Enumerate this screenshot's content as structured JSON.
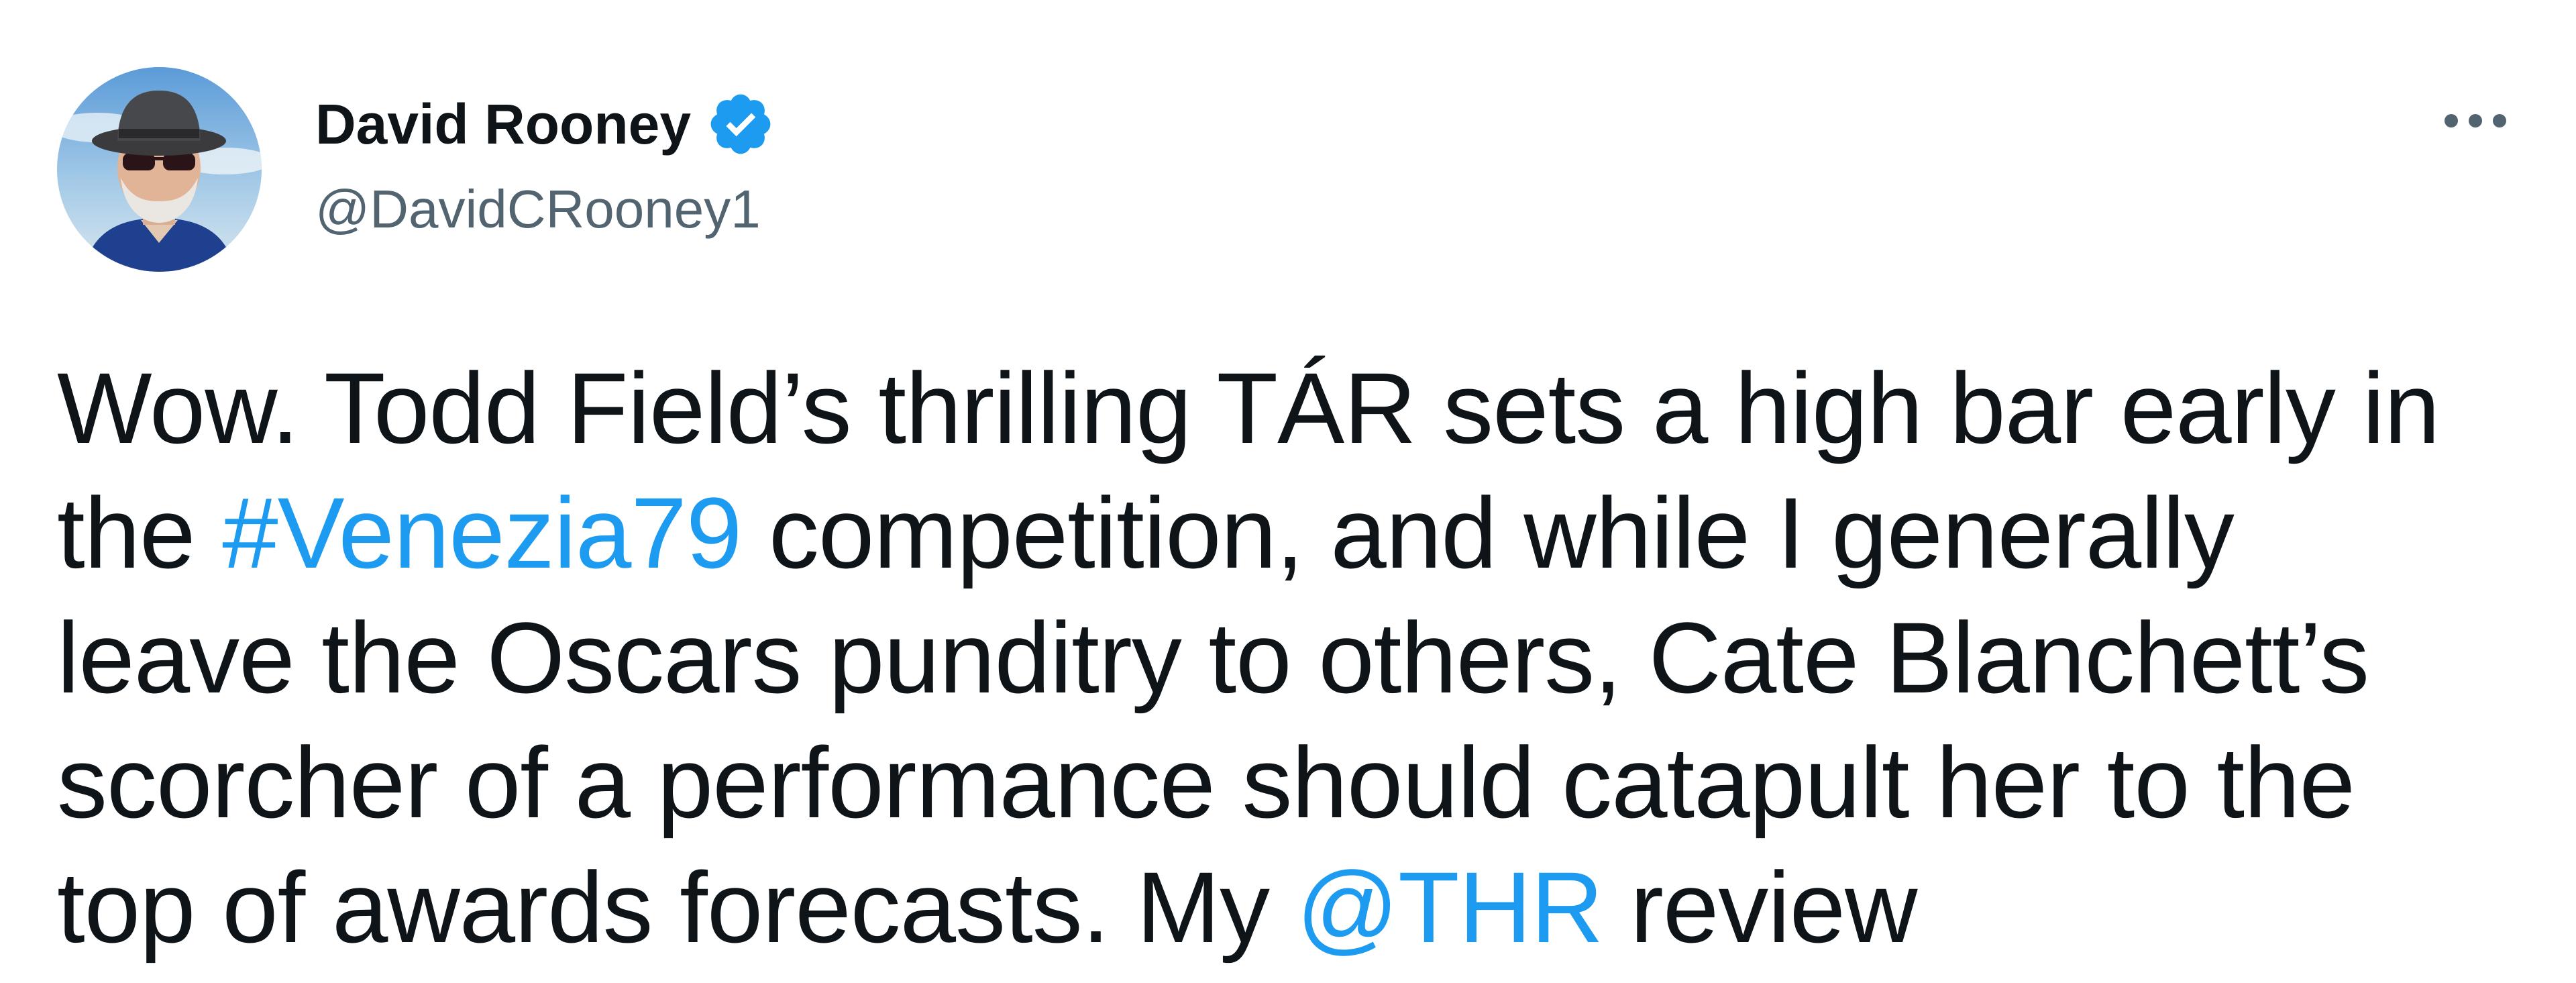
{
  "author": {
    "display_name": "David Rooney",
    "handle": "@DavidCRooney1",
    "verified": true
  },
  "icons": {
    "verified": "verified-badge-icon",
    "more": "more-options-icon"
  },
  "colors": {
    "link": "#1d9bf0",
    "text": "#0f1419",
    "secondary": "#536471"
  },
  "tweet": {
    "line1": "Wow. Todd Field’s thrilling TÁR sets a high bar early in",
    "line2_prefix": "the ",
    "hashtag": "#Venezia79",
    "line2_suffix": " competition, and while I generally",
    "line3": "leave the Oscars punditry to others, Cate Blanchett’s",
    "line4": "scorcher of a performance should catapult her to the",
    "line5_prefix": "top of awards forecasts. My ",
    "mention": "@THR",
    "line5_suffix": " review"
  }
}
